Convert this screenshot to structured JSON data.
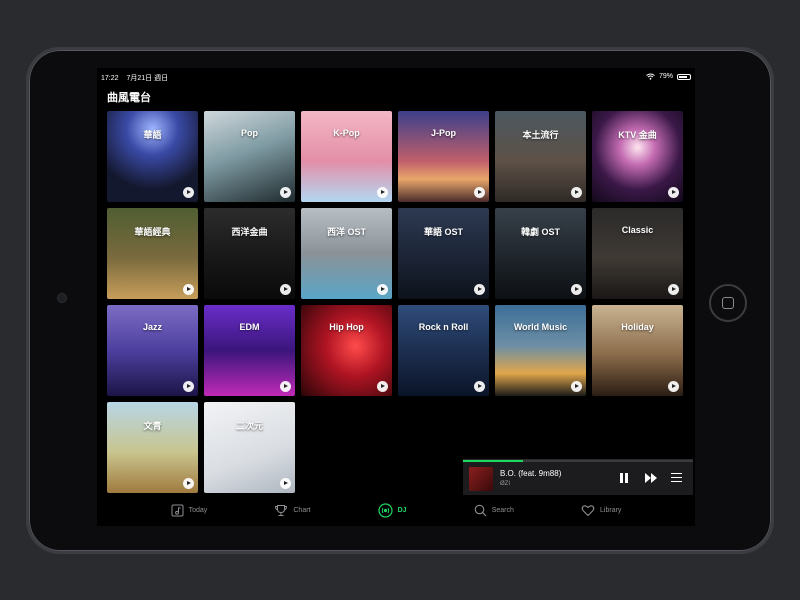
{
  "status_bar": {
    "time": "17:22",
    "date": "7月21日 週日",
    "battery": "79%"
  },
  "page_title": "曲風電台",
  "tiles": [
    {
      "label": "華語",
      "bg": "radial-gradient(circle at 50% 20%, #9fb6ff 0%, #3a4aa6 30%, #14182e 70%)"
    },
    {
      "label": "Pop",
      "bg": "linear-gradient(160deg, #cfd8dc 0%, #7f9ba3 45%, #1f2b2e 100%)"
    },
    {
      "label": "K-Pop",
      "bg": "linear-gradient(180deg, #f3b6c4 0%, #e38fa7 55%, #b3d7f2 100%)"
    },
    {
      "label": "J-Pop",
      "bg": "linear-gradient(180deg, #3b3f8a 0%, #c15f6b 55%, #e8a76a 75%, #4a2b2b 100%)"
    },
    {
      "label": "本土流行",
      "bg": "linear-gradient(180deg, #4b5860 0%, #5e5147 55%, #2f2a26 100%)"
    },
    {
      "label": "KTV 金曲",
      "bg": "radial-gradient(circle at 50% 40%, #ffe6f0 0%, #c36bb2 25%, #3a1847 60%, #12081a 100%)"
    },
    {
      "label": "華語經典",
      "bg": "linear-gradient(180deg, #4f5e32 0%, #7a6a3e 55%, #c79e5a 100%)"
    },
    {
      "label": "西洋金曲",
      "bg": "linear-gradient(180deg, #2c2c2c 0%, #161616 60%, #0a0a0a 100%)"
    },
    {
      "label": "西洋 OST",
      "bg": "linear-gradient(180deg, #b7bec4 0%, #8a9298 50%, #5aa5c7 100%)"
    },
    {
      "label": "華語 OST",
      "bg": "linear-gradient(180deg, #2d3a52 0%, #1a2233 60%, #0d121b 100%)"
    },
    {
      "label": "韓劇 OST",
      "bg": "linear-gradient(180deg, #37404a 0%, #1c2228 60%, #0d1014 100%)"
    },
    {
      "label": "Classic",
      "bg": "linear-gradient(180deg, #2b2a2a 0%, #3f3a34 55%, #1a1716 100%)"
    },
    {
      "label": "Jazz",
      "bg": "linear-gradient(180deg, #7c6cc4 0%, #4c3f9e 50%, #1c1547 100%)"
    },
    {
      "label": "EDM",
      "bg": "linear-gradient(180deg, #6a2ec9 0%, #3b157c 50%, #c02ab7 100%)"
    },
    {
      "label": "Hip Hop",
      "bg": "radial-gradient(circle at 60% 45%, #ff4b4b 0%, #b01423 40%, #2b0508 100%)"
    },
    {
      "label": "Rock n Roll",
      "bg": "linear-gradient(180deg, #2f4c7a 0%, #1b2c4c 55%, #0a1428 100%)"
    },
    {
      "label": "World Music",
      "bg": "linear-gradient(180deg, #3d6e98 0%, #6d8fa5 45%, #e0a64b 75%, #1b1b1b 100%)"
    },
    {
      "label": "Holiday",
      "bg": "linear-gradient(180deg, #c9b391 0%, #8a6b4a 55%, #2b1d14 100%)"
    },
    {
      "label": "文青",
      "bg": "linear-gradient(180deg, #b8d6e6 0%, #c8c58e 55%, #a07a3e 100%)"
    },
    {
      "label": "二次元",
      "bg": "linear-gradient(160deg, #f2f3f5 0%, #d9dde2 60%, #aeb6c0 100%)"
    }
  ],
  "player": {
    "title": "B.O. (feat. 9m88)",
    "artist": "ØZI",
    "progress": 0.26
  },
  "tabs": [
    {
      "label": "Today",
      "icon": "music-note-icon",
      "active": false
    },
    {
      "label": "Chart",
      "icon": "trophy-icon",
      "active": false
    },
    {
      "label": "DJ",
      "icon": "radio-icon",
      "active": true
    },
    {
      "label": "Search",
      "icon": "search-icon",
      "active": false
    },
    {
      "label": "Library",
      "icon": "heart-icon",
      "active": false
    }
  ],
  "colors": {
    "accent": "#1ed760",
    "background": "#000000",
    "inactive": "#8e8e93"
  }
}
